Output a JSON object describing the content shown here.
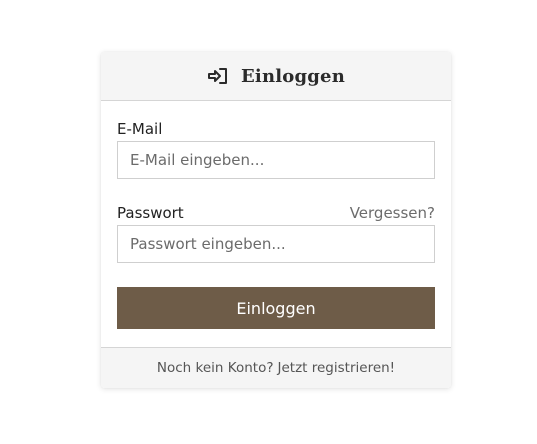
{
  "header": {
    "icon": "login-icon",
    "title": "Einloggen"
  },
  "form": {
    "email": {
      "label": "E-Mail",
      "placeholder": "E-Mail eingeben...",
      "value": ""
    },
    "password": {
      "label": "Passwort",
      "forgot_link": "Vergessen?",
      "placeholder": "Passwort eingeben...",
      "value": ""
    },
    "submit_label": "Einloggen"
  },
  "footer": {
    "text": "Noch kein Konto?",
    "register_link": "Jetzt registrieren!"
  },
  "colors": {
    "button_bg": "#6e5c48",
    "header_bg": "#f5f5f5",
    "link_gray": "#6c6c6c"
  }
}
